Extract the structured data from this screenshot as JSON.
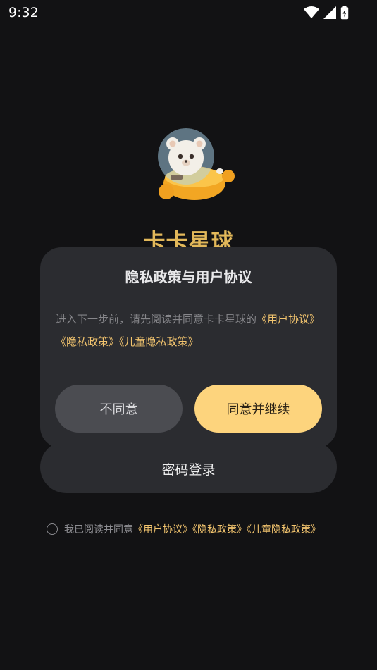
{
  "status_bar": {
    "time": "9:32",
    "icons": [
      "wifi-icon",
      "cellular-signal-icon",
      "battery-charging-icon"
    ]
  },
  "app": {
    "brand": "卡卡星球",
    "logo": "astronaut-bear-spaceship-logo"
  },
  "login": {
    "password_login_label": "密码登录",
    "agreement_prefix": "我已阅读并同意",
    "agreement_links": [
      "《用户协议》",
      "《隐私政策》",
      "《儿童隐私政策》"
    ]
  },
  "dialog": {
    "title": "隐私政策与用户协议",
    "body_prefix": "进入下一步前，请先阅读并同意卡卡星球的",
    "links": [
      "《用户协议》",
      "《隐私政策》",
      "《儿童隐私政策》"
    ],
    "disagree_label": "不同意",
    "agree_label": "同意并继续"
  },
  "colors": {
    "background": "#121214",
    "dialog": "#2b2c30",
    "accent": "#fdd47d",
    "link": "#f2c46e"
  }
}
